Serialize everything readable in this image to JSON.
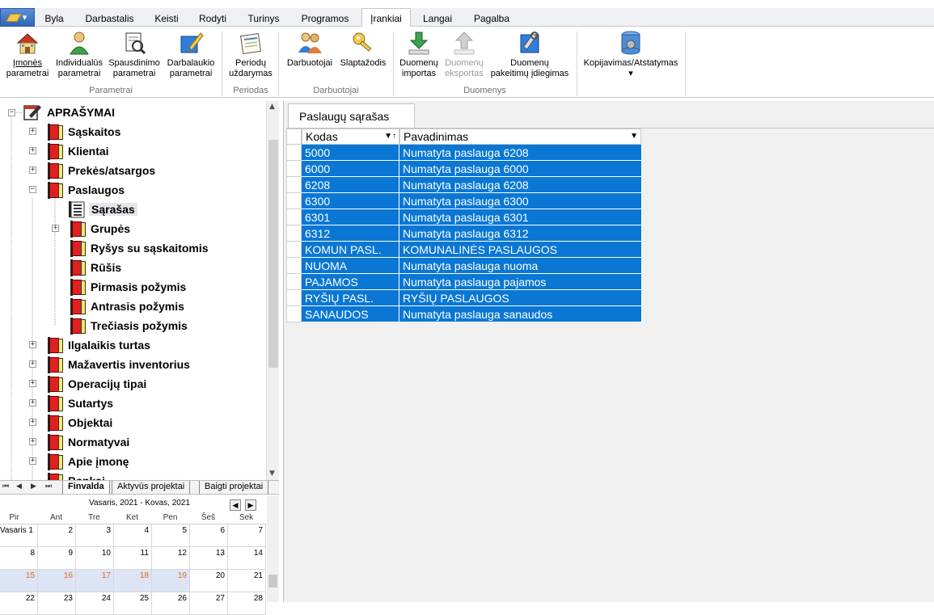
{
  "menu": {
    "tabs": [
      "Byla",
      "Darbastalis",
      "Keisti",
      "Rodyti",
      "Turinys",
      "Programos",
      "Įrankiai",
      "Langai",
      "Pagalba"
    ],
    "active_tab": "Įrankiai"
  },
  "ribbon": {
    "groups": [
      {
        "label": "Parametrai",
        "buttons": [
          {
            "line1": "Įmonės",
            "line2": "parametrai"
          },
          {
            "line1": "Individualūs",
            "line2": "parametrai"
          },
          {
            "line1": "Spausdinimo",
            "line2": "parametrai"
          },
          {
            "line1": "Darbalaukio",
            "line2": "parametrai"
          }
        ]
      },
      {
        "label": "Periodas",
        "buttons": [
          {
            "line1": "Periodų",
            "line2": "uždarymas"
          }
        ]
      },
      {
        "label": "Darbuotojai",
        "buttons": [
          {
            "line1": "Darbuotojai",
            "line2": ""
          },
          {
            "line1": "Slaptažodis",
            "line2": ""
          }
        ]
      },
      {
        "label": "Duomenys",
        "buttons": [
          {
            "line1": "Duomenų",
            "line2": "importas"
          },
          {
            "line1": "Duomenų",
            "line2": "eksportas"
          },
          {
            "line1": "Duomenų",
            "line2": "pakeitimų įdiegimas"
          }
        ]
      },
      {
        "label": "",
        "buttons": [
          {
            "line1": "Kopijavimas/Atstatymas",
            "line2": "▾"
          }
        ]
      }
    ]
  },
  "tree": {
    "root": "APRAŠYMAI",
    "items": [
      "Sąskaitos",
      "Klientai",
      "Prekės/atsargos",
      "Paslaugos",
      "Sąrašas",
      "Grupės",
      "Ryšys su sąskaitomis",
      "Rūšis",
      "Pirmasis požymis",
      "Antrasis požymis",
      "Trečiasis požymis",
      "Ilgalaikis turtas",
      "Mažavertis inventorius",
      "Operacijų tipai",
      "Sutartys",
      "Objektai",
      "Normatyvai",
      "Apie įmonę",
      "Bankai"
    ]
  },
  "navtabs": {
    "buttons": [
      "⏮",
      "◀",
      "▶",
      "⏭"
    ],
    "tabs": [
      "Finvalda",
      "Aktyvūs projektai",
      "Baigti projektai"
    ]
  },
  "calendar": {
    "title": "Vasaris, 2021 - Kovas, 2021",
    "days_of_week": [
      "Pir",
      "Ant",
      "Tre",
      "Ket",
      "Pen",
      "Šeš",
      "Sek"
    ],
    "weeks": [
      [
        "Vasaris 1",
        "2",
        "3",
        "4",
        "5",
        "6",
        "7"
      ],
      [
        "8",
        "9",
        "10",
        "11",
        "12",
        "13",
        "14"
      ],
      [
        "15",
        "16",
        "17",
        "18",
        "19",
        "20",
        "21"
      ],
      [
        "22",
        "23",
        "24",
        "25",
        "26",
        "27",
        "28"
      ]
    ]
  },
  "content": {
    "tab_title": "Paslaugų sąrašas",
    "columns": [
      "Kodas",
      "Pavadinimas"
    ],
    "rows": [
      [
        "5000",
        "Numatyta paslauga 6208"
      ],
      [
        "6000",
        "Numatyta paslauga 6000"
      ],
      [
        "6208",
        "Numatyta paslauga 6208"
      ],
      [
        "6300",
        "Numatyta paslauga 6300"
      ],
      [
        "6301",
        "Numatyta paslauga 6301"
      ],
      [
        "6312",
        "Numatyta paslauga 6312"
      ],
      [
        "KOMUN PASL.",
        "KOMUNALINĖS PASLAUGOS"
      ],
      [
        "NUOMA",
        "Numatyta paslauga nuoma"
      ],
      [
        "PAJAMOS",
        "Numatyta paslauga pajamos"
      ],
      [
        "RYŠIŲ PASL.",
        "RYŠIŲ PASLAUGOS"
      ],
      [
        "SANAUDOS",
        "Numatyta paslauga sanaudos"
      ]
    ]
  },
  "colors": {
    "selection": "#0a77d4",
    "book_cover": "#e02020",
    "book_pages": "#f5e96a",
    "weekend_selected_text": "#e06a1c"
  }
}
